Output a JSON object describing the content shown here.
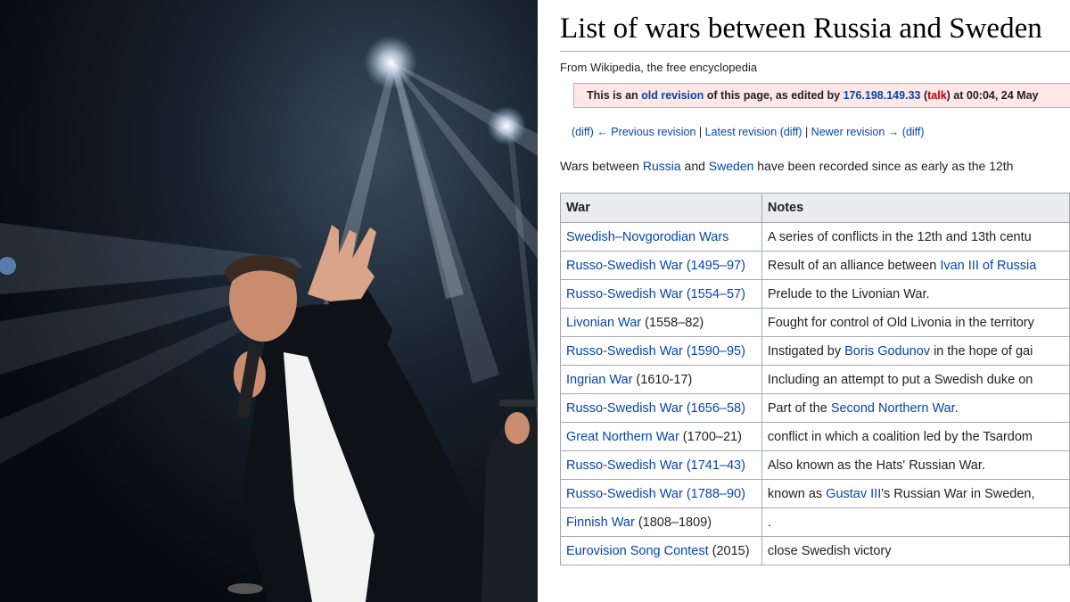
{
  "wiki": {
    "title": "List of wars between Russia and Sweden",
    "from": "From Wikipedia, the free encyclopedia",
    "notice": {
      "pre": "This is an ",
      "link1": "old revision",
      "mid": " of this page, as edited by ",
      "ip": "176.198.149.33",
      "open": " (",
      "talk": "talk",
      "post": ") at 00:04, 24 May"
    },
    "revnav": {
      "diff1": "(diff)",
      "prev": " ← Previous revision",
      "sep1": " | ",
      "latest": "Latest revision",
      "diff2": " (diff)",
      "sep2": " | ",
      "newer": "Newer revision →",
      "diff3": " (diff)"
    },
    "intro": {
      "pre": "Wars between ",
      "russia": "Russia",
      "and": " and ",
      "sweden": "Sweden",
      "post": " have been recorded since as early as the 12th"
    },
    "table": {
      "headers": [
        "War",
        "Notes"
      ],
      "rows": [
        {
          "war_link": "Swedish–Novgorodian Wars",
          "war_rest": "",
          "note_pre": "A series of conflicts in the 12th and 13th centu",
          "note_link": "",
          "note_post": ""
        },
        {
          "war_link": "Russo-Swedish War (1495–97)",
          "war_rest": "",
          "note_pre": "Result of an alliance between ",
          "note_link": "Ivan III of Russia",
          "note_post": ""
        },
        {
          "war_link": "Russo-Swedish War (1554–57)",
          "war_rest": "",
          "note_pre": "Prelude to the Livonian War.",
          "note_link": "",
          "note_post": ""
        },
        {
          "war_link": "Livonian War",
          "war_rest": " (1558–82)",
          "note_pre": "Fought for control of Old Livonia in the territory",
          "note_link": "",
          "note_post": ""
        },
        {
          "war_link": "Russo-Swedish War (1590–95)",
          "war_rest": "",
          "note_pre": "Instigated by ",
          "note_link": "Boris Godunov",
          "note_post": " in the hope of gai"
        },
        {
          "war_link": "Ingrian War",
          "war_rest": " (1610-17)",
          "note_pre": "Including an attempt to put a Swedish duke on",
          "note_link": "",
          "note_post": ""
        },
        {
          "war_link": "Russo-Swedish War (1656–58)",
          "war_rest": "",
          "note_pre": "Part of the ",
          "note_link": "Second Northern War",
          "note_post": "."
        },
        {
          "war_link": "Great Northern War",
          "war_rest": " (1700–21)",
          "note_pre": "conflict in which a coalition led by the Tsardom",
          "note_link": "",
          "note_post": ""
        },
        {
          "war_link": "Russo-Swedish War (1741–43)",
          "war_rest": "",
          "note_pre": "Also known as the Hats' Russian War.",
          "note_link": "",
          "note_post": ""
        },
        {
          "war_link": "Russo-Swedish War (1788–90)",
          "war_rest": "",
          "note_pre": "known as ",
          "note_link": "Gustav III",
          "note_post": "'s Russian War in Sweden,"
        },
        {
          "war_link": "Finnish War",
          "war_rest": " (1808–1809)",
          "note_pre": ".",
          "note_link": "",
          "note_post": ""
        },
        {
          "war_link": "Eurovision Song Contest",
          "war_rest": " (2015)",
          "note_pre": "close Swedish victory",
          "note_link": "",
          "note_post": ""
        }
      ]
    }
  },
  "colors": {
    "link": "#0645ad",
    "red_link": "#ba0000",
    "notice_bg": "#fee7e6",
    "table_border": "#a2a9b1",
    "header_bg": "#eaecf0"
  }
}
